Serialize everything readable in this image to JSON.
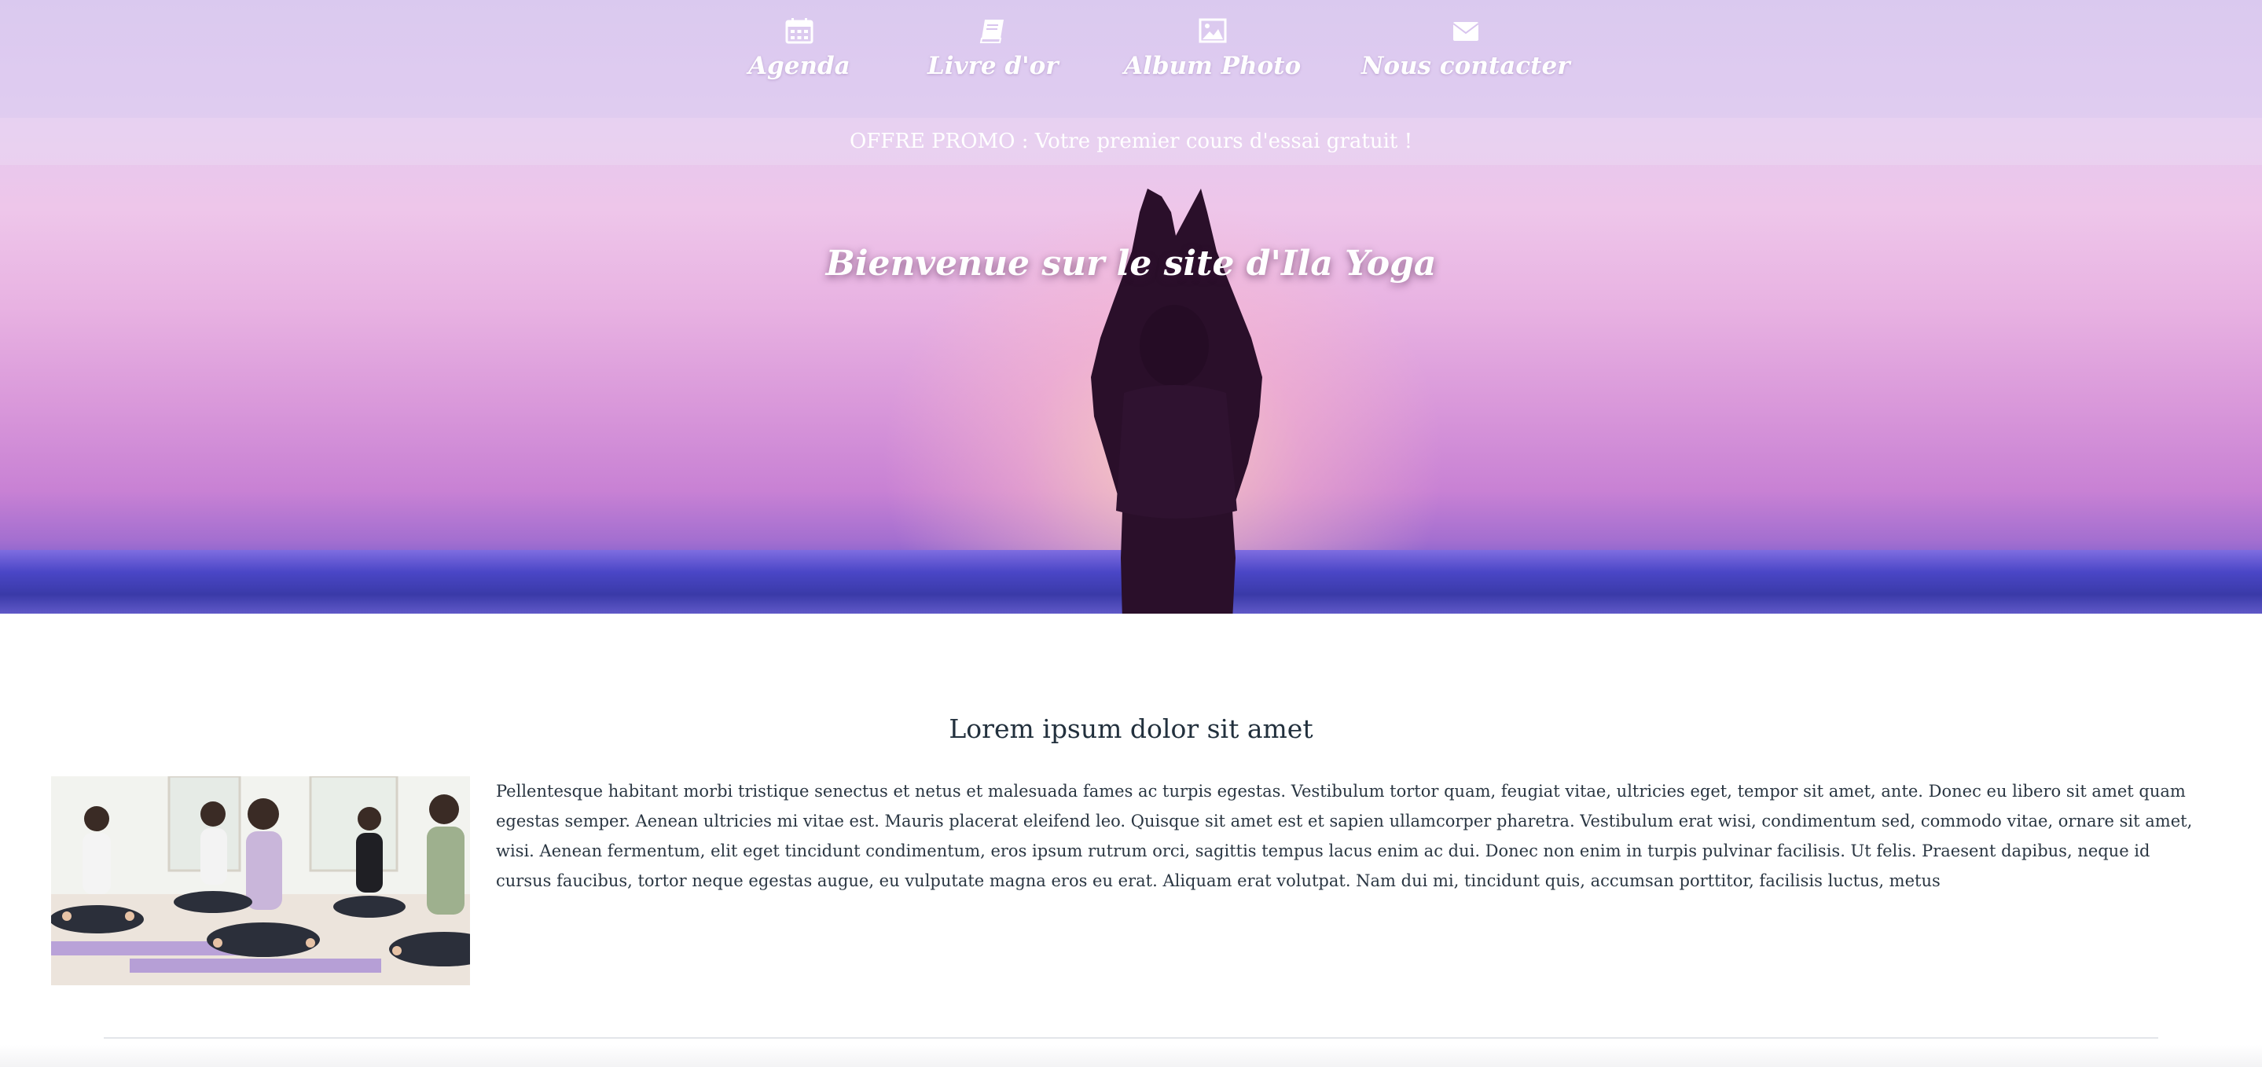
{
  "nav": {
    "items": [
      {
        "label": "Agenda",
        "icon": "calendar-icon"
      },
      {
        "label": "Livre d'or",
        "icon": "book-icon"
      },
      {
        "label": "Album Photo",
        "icon": "image-icon"
      },
      {
        "label": "Nous contacter",
        "icon": "envelope-icon"
      }
    ]
  },
  "promo": {
    "text": "OFFRE PROMO : Votre premier cours d'essai gratuit !"
  },
  "hero": {
    "title": "Bienvenue sur le site d'Ila Yoga"
  },
  "section": {
    "title": "Lorem ipsum dolor sit amet",
    "body": "Pellentesque habitant morbi tristique senectus et netus et malesuada fames ac turpis egestas. Vestibulum tortor quam, feugiat vitae, ultricies eget, tempor sit amet, ante. Donec eu libero sit amet quam egestas semper. Aenean ultricies mi vitae est. Mauris placerat eleifend leo. Quisque sit amet est et sapien ullamcorper pharetra. Vestibulum erat wisi, condimentum sed, commodo vitae, ornare sit amet, wisi. Aenean fermentum, elit eget tincidunt condimentum, eros ipsum rutrum orci, sagittis tempus lacus enim ac dui. Donec non enim in turpis pulvinar facilisis. Ut felis. Praesent dapibus, neque id cursus faucibus, tortor neque egestas augue, eu vulputate magna eros eu erat. Aliquam erat volutpat. Nam dui mi, tincidunt quis, accumsan porttitor, facilisis luctus, metus"
  },
  "colors": {
    "text_dark": "#22303d",
    "nav_text": "#ffffff",
    "hero_pink": "#e8b2e2",
    "sea_blue": "#4a46c6"
  }
}
